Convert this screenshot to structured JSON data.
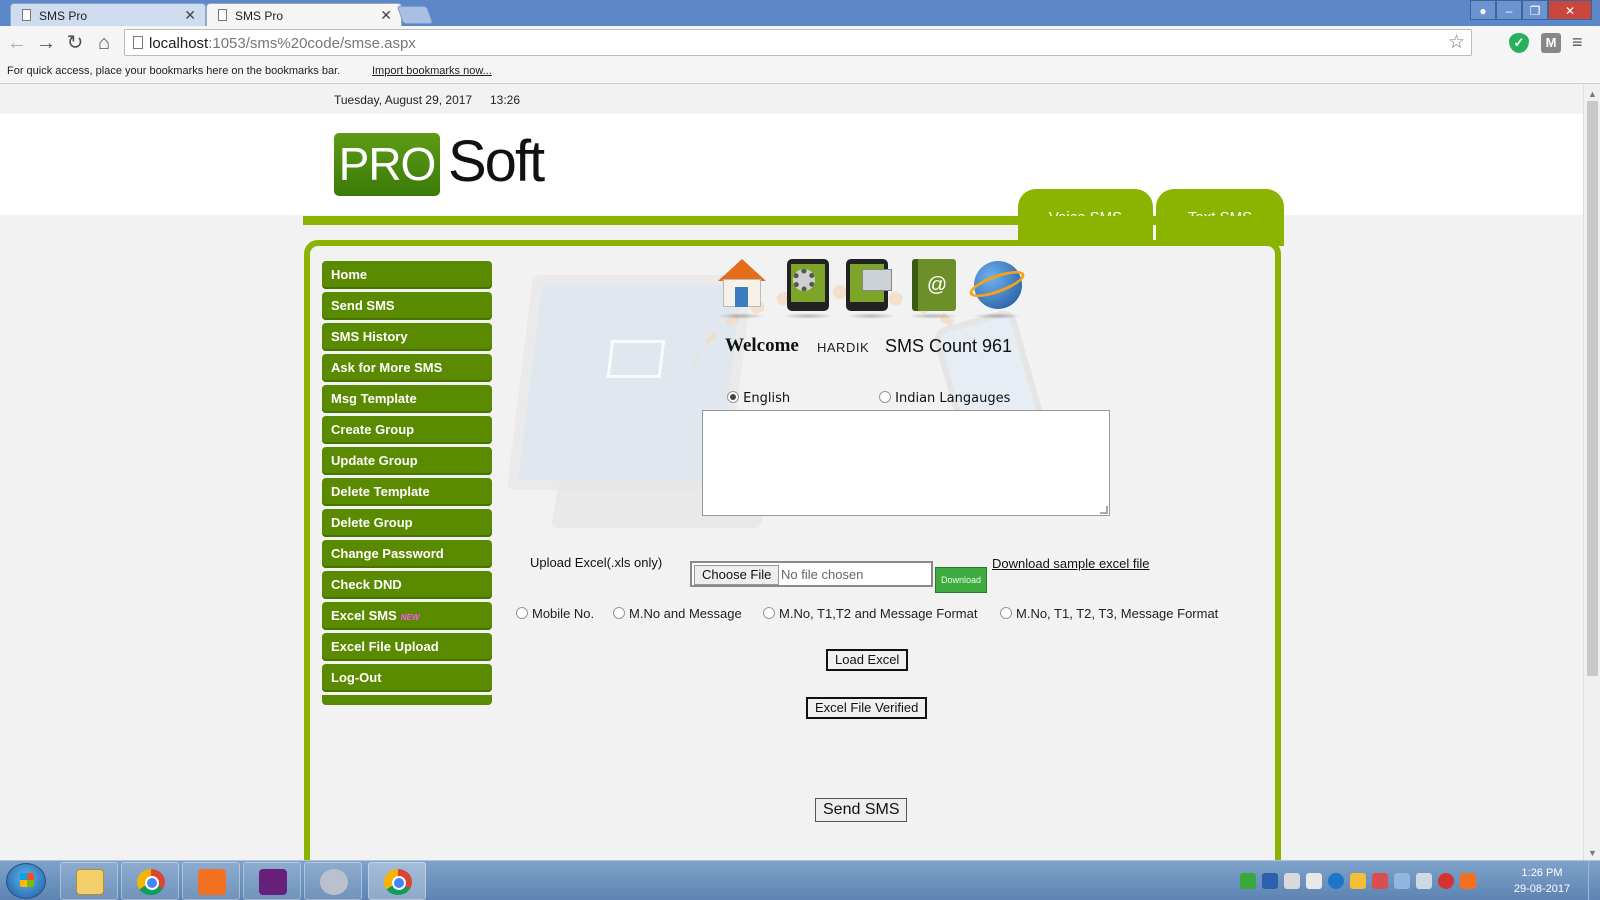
{
  "browser": {
    "tabs": [
      {
        "title": "SMS Pro",
        "active": false
      },
      {
        "title": "SMS Pro",
        "active": true
      }
    ],
    "url_host": "localhost",
    "url_path": ":1053/sms%20code/smse.aspx",
    "bookmarks_text": "For quick access, place your bookmarks here on the bookmarks bar.",
    "bookmarks_link": "Import bookmarks now...",
    "extension_m": "M"
  },
  "page": {
    "date": "Tuesday, August 29, 2017",
    "time": "13:26",
    "logo": {
      "pro": "PRO",
      "soft": "Soft"
    },
    "header_tabs": [
      "Voice SMS",
      "Text SMS"
    ],
    "sidebar": [
      {
        "label": "Home"
      },
      {
        "label": "Send SMS"
      },
      {
        "label": "SMS History"
      },
      {
        "label": "Ask for More SMS"
      },
      {
        "label": "Msg Template"
      },
      {
        "label": "Create Group"
      },
      {
        "label": "Update Group"
      },
      {
        "label": "Delete Template"
      },
      {
        "label": "Delete Group"
      },
      {
        "label": "Change Password"
      },
      {
        "label": "Check DND"
      },
      {
        "label": "Excel SMS",
        "badge": "NEW"
      },
      {
        "label": "Excel File Upload"
      },
      {
        "label": "Log-Out"
      }
    ],
    "top_icons": [
      "home-icon",
      "settings-phone-icon",
      "message-phone-icon",
      "address-book-icon",
      "internet-globe-icon"
    ],
    "address_book_glyph": "@",
    "welcome_label": "Welcome",
    "username": "HARDIK",
    "sms_count": "SMS Count 961",
    "language": {
      "english": "English",
      "indian": "Indian Langauges",
      "selected": "English"
    },
    "message_text": "",
    "upload": {
      "label": "Upload Excel(.xls only)",
      "choose_button": "Choose File",
      "no_file": "No file chosen",
      "download_button": "Download",
      "download_link": "Download sample excel file"
    },
    "formats": [
      "Mobile No.",
      "M.No and Message",
      "M.No, T1,T2 and Message Format",
      "M.No, T1, T2, T3, Message Format"
    ],
    "load_button": "Load Excel",
    "verified_button": "Excel File Verified",
    "send_button": "Send SMS",
    "colors": {
      "brand_green": "#8ab400",
      "nav_green": "#5a8a00"
    }
  },
  "taskbar": {
    "apps": [
      "windows-explorer",
      "google-chrome",
      "xampp",
      "visual-studio",
      "blender",
      "google-chrome"
    ],
    "clock_time": "1:26 PM",
    "clock_date": "29-08-2017"
  }
}
